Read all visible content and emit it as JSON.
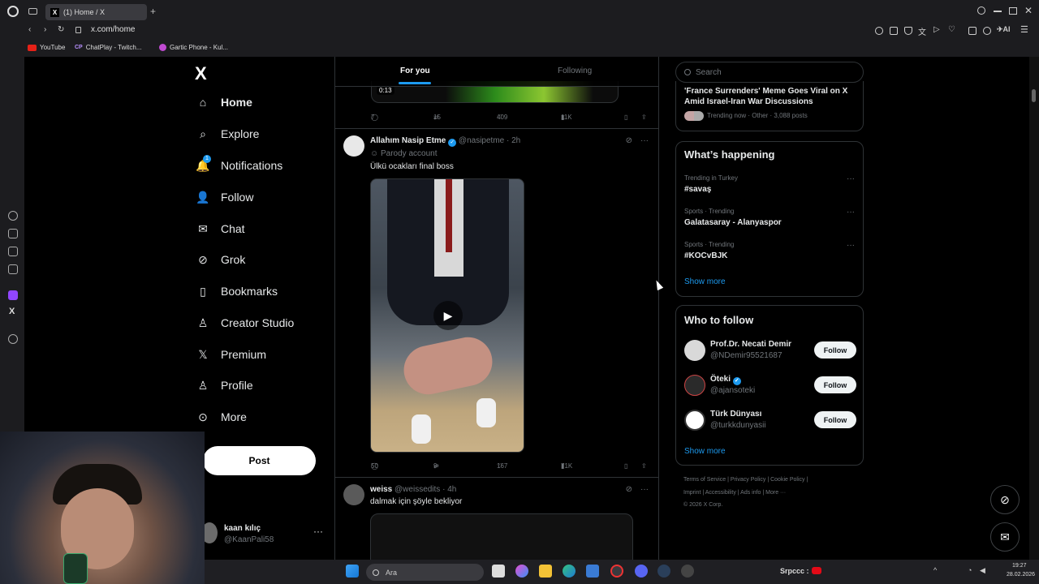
{
  "browser": {
    "tab_title": "(1) Home / X",
    "url": "x.com/home",
    "bookmarks": [
      "YouTube",
      "ChatPlay - Twitch...",
      "Gartic Phone - Kul..."
    ]
  },
  "nav": {
    "logo": "X",
    "items": [
      {
        "label": "Home",
        "icon": "home-icon"
      },
      {
        "label": "Explore",
        "icon": "search-icon"
      },
      {
        "label": "Notifications",
        "icon": "bell-icon",
        "badge": "1"
      },
      {
        "label": "Follow",
        "icon": "person-add-icon"
      },
      {
        "label": "Chat",
        "icon": "envelope-icon"
      },
      {
        "label": "Grok",
        "icon": "grok-icon"
      },
      {
        "label": "Bookmarks",
        "icon": "bookmark-icon"
      },
      {
        "label": "Creator Studio",
        "icon": "creator-icon"
      },
      {
        "label": "Premium",
        "icon": "x-icon"
      },
      {
        "label": "Profile",
        "icon": "person-icon"
      },
      {
        "label": "More",
        "icon": "more-circle-icon"
      }
    ],
    "post_label": "Post",
    "account": {
      "name": "kaan kılıç",
      "handle": "@KaanPali58",
      "menu": "···"
    }
  },
  "feed": {
    "tabs": [
      "For you",
      "Following"
    ],
    "prev_tweet": {
      "duration": "0:13",
      "replies": "7",
      "reposts": "15",
      "likes": "409",
      "views": "11K"
    },
    "tweet1": {
      "name": "Allahım Nasip Etme",
      "handle": "@nasipetme",
      "time": "· 2h",
      "subtitle": "Parody account",
      "text": "Ülkü ocakları final boss",
      "replies": "50",
      "reposts": "9",
      "likes": "167",
      "views": "71K"
    },
    "tweet2": {
      "name": "weiss",
      "handle": "@weissedits",
      "time": "· 4h",
      "text": "dalmak için şöyle bekliyor"
    },
    "menu": "···"
  },
  "sidebar": {
    "search_placeholder": "Search",
    "top_trend": {
      "title": "'France Surrenders' Meme Goes Viral on X Amid Israel-Iran War Discussions",
      "meta": "Trending now · Other · 3,088 posts"
    },
    "happening": {
      "title": "What’s happening",
      "trends": [
        {
          "meta": "Trending in Turkey",
          "name": "#savaş"
        },
        {
          "meta": "Sports · Trending",
          "name": "Galatasaray - Alanyaspor"
        },
        {
          "meta": "Sports · Trending",
          "name": "#KOCvBJK"
        }
      ],
      "show_more": "Show more"
    },
    "who_to_follow": {
      "title": "Who to follow",
      "users": [
        {
          "name": "Prof.Dr. Necati Demir",
          "handle": "@NDemir95521687",
          "verified": false
        },
        {
          "name": "Öteki",
          "handle": "@ajansoteki",
          "verified": true
        },
        {
          "name": "Türk Dünyası",
          "handle": "@turkkdunyasii",
          "verified": false
        }
      ],
      "follow_label": "Follow",
      "show_more": "Show more"
    },
    "footer": {
      "line1": "Terms of Service  |  Privacy Policy  |  Cookie Policy  |",
      "line2": "Imprint  |  Accessibility  |  Ads info  |  More ···",
      "line3": "© 2026 X Corp."
    }
  },
  "taskbar": {
    "search": "Ara",
    "app_label": "Srpccc :",
    "time": "19:27",
    "date": "28.02.2026"
  },
  "colors": {
    "accent": "#1d9bf0",
    "background": "#000000",
    "border": "#2f3336",
    "muted": "#71767b"
  }
}
